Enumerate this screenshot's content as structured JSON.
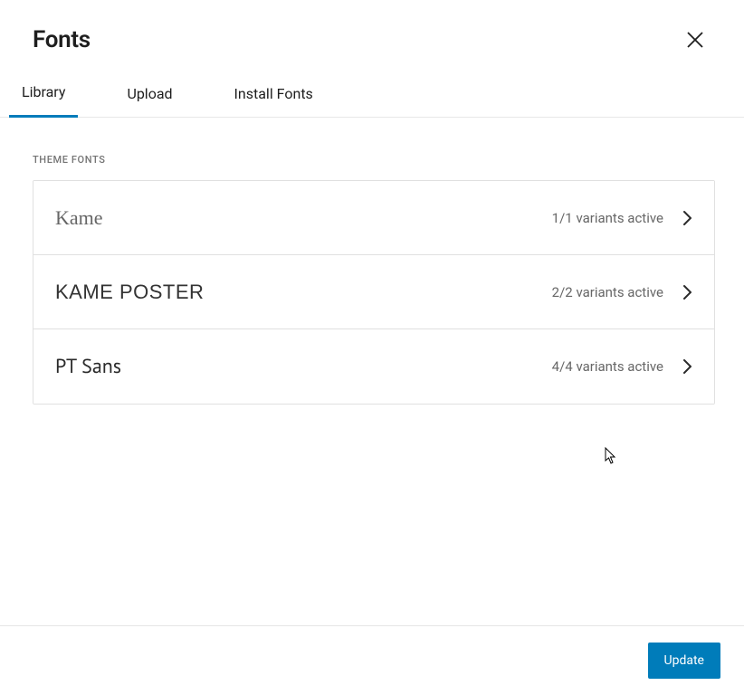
{
  "header": {
    "title": "Fonts"
  },
  "tabs": {
    "library": "Library",
    "upload": "Upload",
    "install": "Install Fonts",
    "active": "library"
  },
  "section": {
    "theme_fonts_label": "THEME FONTS"
  },
  "fonts": {
    "kame": {
      "name": "Kame",
      "variants": "1/1 variants active"
    },
    "kame_poster": {
      "name": "KAME POSTER",
      "variants": "2/2 variants active"
    },
    "pt_sans": {
      "name": "PT Sans",
      "variants": "4/4 variants active"
    }
  },
  "footer": {
    "update_label": "Update"
  },
  "colors": {
    "accent": "#007cba",
    "border": "#e0e0e0",
    "text_muted": "#757575"
  }
}
